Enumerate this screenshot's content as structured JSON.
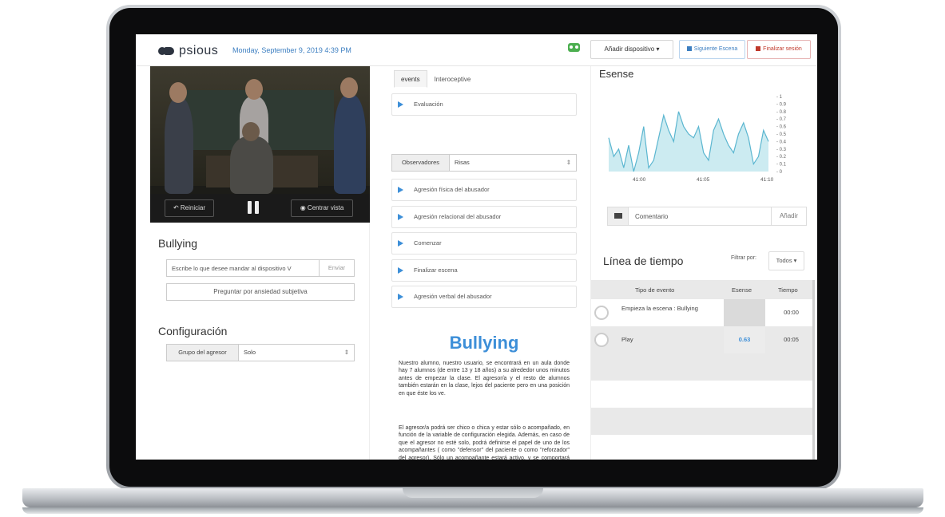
{
  "app": {
    "logo_text": "psious",
    "datetime": "Monday, September 9, 2019 4:39 PM",
    "add_device_label": "Añadir dispositivo ▾",
    "next_scene_label": "Siguiente Escena",
    "end_session_label": "Finalizar sesión",
    "colors": {
      "accent": "#3d8fd8",
      "danger": "#c0392b",
      "vr": "#4caf50"
    }
  },
  "video": {
    "restart_label": "Reiniciar",
    "center_view_label": "Centrar vista"
  },
  "left": {
    "scene_title": "Bullying",
    "message_placeholder": "Escribe lo que desee mandar al dispositivo V",
    "send_label": "Enviar",
    "ask_anxiety_label": "Preguntar por ansiedad subjetiva",
    "config_title": "Configuración",
    "aggressor_group_label": "Grupo del agresor",
    "aggressor_group_value": "Solo"
  },
  "middle": {
    "tabs": [
      {
        "label": "events"
      },
      {
        "label": "Interoceptive"
      }
    ],
    "events": [
      {
        "label": "Evaluación"
      },
      {
        "label": "Agresión física del abusador"
      },
      {
        "label": "Agresión relacional del abusador"
      },
      {
        "label": "Comenzar"
      },
      {
        "label": "Finalizar escena"
      },
      {
        "label": "Agresión verbal del abusador"
      }
    ],
    "observers_label": "Observadores",
    "observers_value": "Risas",
    "doc_title": "Bullying",
    "doc_paragraphs": [
      "Nuestro alumno, nuestro usuario, se encontrará en un aula donde hay 7 alumnos (de entre 13 y 18 años) a su alrededor unos minutos antes de empezar la clase. El agresor/a y el resto de alumnos también estarán en la clase, lejos del paciente pero en una posición en que éste los ve.",
      "El agresor/a podrá ser chico o chica y estar sólo o acompañado, en función de la variable de configuración elegida. Además, en caso de que el agresor no esté solo, podrá definirse el papel de uno de los acompañantes ( como \"defensor\" del paciente o como \"reforzador\" del agresor). Sólo un acompañante estará activo, y se comportará según"
    ]
  },
  "right": {
    "esense_title": "Esense",
    "comment_placeholder": "Comentario",
    "add_label": "Añadir",
    "timeline_title": "Línea de tiempo",
    "filter_label": "Filtrar por:",
    "filter_value": "Todos ▾",
    "table_headers": {
      "type": "Tipo de evento",
      "esense": "Esense",
      "time": "Tiempo"
    },
    "rows": [
      {
        "type": "Empieza la escena : Bullying",
        "esense": "",
        "time": "00:00"
      },
      {
        "type": "Play",
        "esense": "0.63",
        "time": "00:05"
      }
    ]
  },
  "chart_data": {
    "type": "area",
    "title": "Esense",
    "x_ticks": [
      "41:00",
      "41:05",
      "41:10"
    ],
    "y_ticks": [
      "1",
      "0.9",
      "0.8",
      "0.7",
      "0.6",
      "0.5",
      "0.4",
      "0.3",
      "0.2",
      "0.1",
      "0"
    ],
    "ylim": [
      0,
      1
    ],
    "series": [
      {
        "values": [
          0.45,
          0.2,
          0.3,
          0.05,
          0.35,
          0.0,
          0.25,
          0.6,
          0.05,
          0.15,
          0.45,
          0.75,
          0.55,
          0.4,
          0.8,
          0.6,
          0.5,
          0.45,
          0.6,
          0.25,
          0.15,
          0.55,
          0.7,
          0.5,
          0.35,
          0.25,
          0.5,
          0.65,
          0.45,
          0.1,
          0.2,
          0.55,
          0.4
        ]
      }
    ],
    "color": "#8fd3e0"
  }
}
